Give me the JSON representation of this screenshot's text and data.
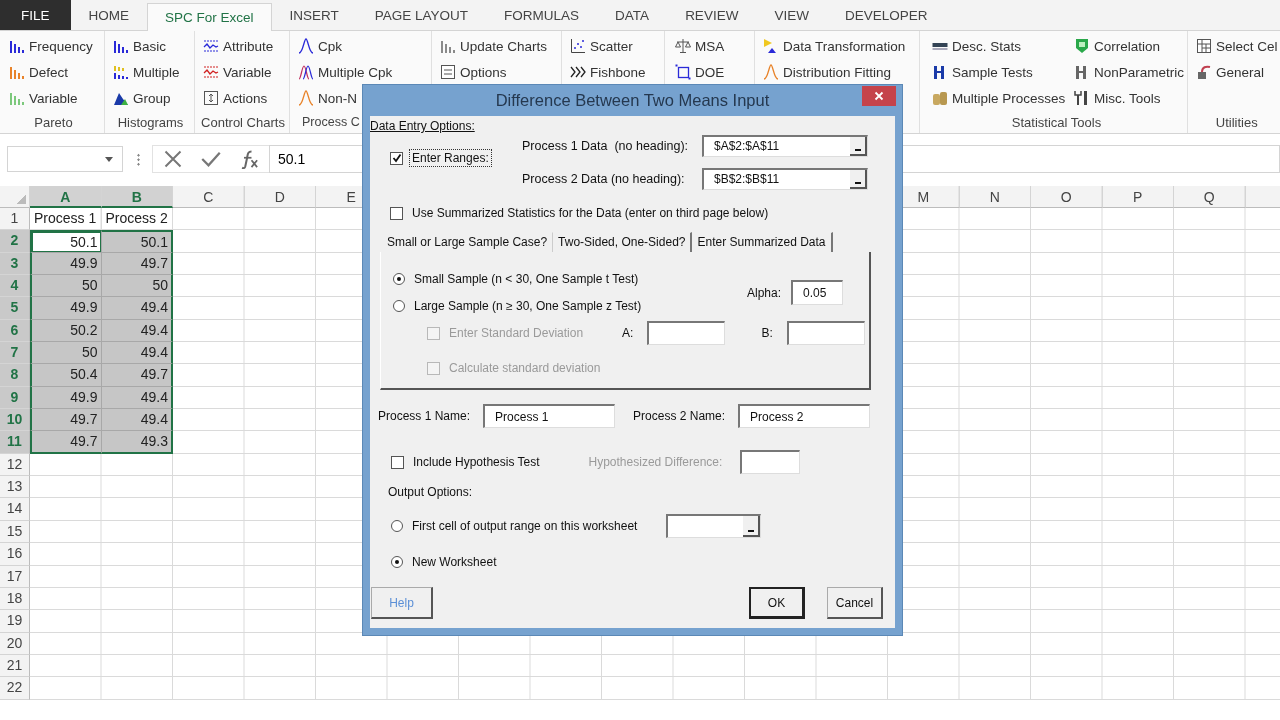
{
  "ribbon": {
    "tabs": [
      {
        "label": "FILE",
        "kind": "file",
        "selected": false
      },
      {
        "label": "HOME",
        "kind": "tab",
        "selected": false
      },
      {
        "label": "SPC For Excel",
        "kind": "tab",
        "selected": true
      },
      {
        "label": "INSERT",
        "kind": "tab",
        "selected": false
      },
      {
        "label": "PAGE LAYOUT",
        "kind": "tab",
        "selected": false
      },
      {
        "label": "FORMULAS",
        "kind": "tab",
        "selected": false
      },
      {
        "label": "DATA",
        "kind": "tab",
        "selected": false
      },
      {
        "label": "REVIEW",
        "kind": "tab",
        "selected": false
      },
      {
        "label": "VIEW",
        "kind": "tab",
        "selected": false
      },
      {
        "label": "DEVELOPER",
        "kind": "tab",
        "selected": false
      }
    ],
    "groups": [
      {
        "label": "Pareto",
        "items": [
          "Frequency",
          "Defect",
          "Variable"
        ]
      },
      {
        "label": "Histograms",
        "items": [
          "Basic",
          "Multiple",
          "Group"
        ]
      },
      {
        "label": "Control Charts",
        "items": [
          "Attribute",
          "Variable",
          "Actions"
        ]
      },
      {
        "label": "Process C",
        "items": [
          "Cpk",
          "Multiple Cpk",
          "Non-N"
        ]
      },
      {
        "items": [
          "Update Charts",
          "Options"
        ]
      },
      {
        "items": [
          "Scatter",
          "Fishbone"
        ]
      },
      {
        "items": [
          "MSA",
          "DOE"
        ]
      },
      {
        "items": [
          "Data Transformation",
          "Distribution Fitting"
        ]
      },
      {
        "label": "Statistical Tools",
        "items": [
          "Desc. Stats",
          "Sample Tests",
          "Multiple Processes",
          "Correlation",
          "NonParametric",
          "Misc. Tools"
        ]
      },
      {
        "label": "Utilities",
        "items": [
          "Select Cel",
          "General"
        ]
      }
    ]
  },
  "formula_bar": {
    "value": "50.1"
  },
  "sheet": {
    "columns": [
      {
        "label": "A",
        "selected": true
      },
      {
        "label": "B",
        "selected": true
      },
      {
        "label": "C",
        "selected": false
      },
      {
        "label": "D",
        "selected": false
      },
      {
        "label": "E",
        "selected": false
      }
    ],
    "columns_right": [
      {
        "label": "M",
        "selected": false
      },
      {
        "label": "N",
        "selected": false
      },
      {
        "label": "O",
        "selected": false
      },
      {
        "label": "P",
        "selected": false
      },
      {
        "label": "Q",
        "selected": false
      }
    ],
    "rows": [
      {
        "number": "1",
        "selected": false,
        "cells": [
          {
            "value": "Process 1",
            "selected": false,
            "active": false
          },
          {
            "value": "Process 2",
            "selected": false,
            "active": false
          }
        ]
      },
      {
        "number": "2",
        "selected": true,
        "cells": [
          {
            "value": "50.1",
            "selected": true,
            "active": true
          },
          {
            "value": "50.1",
            "selected": true,
            "active": false
          }
        ]
      },
      {
        "number": "3",
        "selected": true,
        "cells": [
          {
            "value": "49.9",
            "selected": true,
            "active": false
          },
          {
            "value": "49.7",
            "selected": true,
            "active": false
          }
        ]
      },
      {
        "number": "4",
        "selected": true,
        "cells": [
          {
            "value": "50",
            "selected": true,
            "active": false
          },
          {
            "value": "50",
            "selected": true,
            "active": false
          }
        ]
      },
      {
        "number": "5",
        "selected": true,
        "cells": [
          {
            "value": "49.9",
            "selected": true,
            "active": false
          },
          {
            "value": "49.4",
            "selected": true,
            "active": false
          }
        ]
      },
      {
        "number": "6",
        "selected": true,
        "cells": [
          {
            "value": "50.2",
            "selected": true,
            "active": false
          },
          {
            "value": "49.4",
            "selected": true,
            "active": false
          }
        ]
      },
      {
        "number": "7",
        "selected": true,
        "cells": [
          {
            "value": "50",
            "selected": true,
            "active": false
          },
          {
            "value": "49.4",
            "selected": true,
            "active": false
          }
        ]
      },
      {
        "number": "8",
        "selected": true,
        "cells": [
          {
            "value": "50.4",
            "selected": true,
            "active": false
          },
          {
            "value": "49.7",
            "selected": true,
            "active": false
          }
        ]
      },
      {
        "number": "9",
        "selected": true,
        "cells": [
          {
            "value": "49.9",
            "selected": true,
            "active": false
          },
          {
            "value": "49.4",
            "selected": true,
            "active": false
          }
        ]
      },
      {
        "number": "10",
        "selected": true,
        "cells": [
          {
            "value": "49.7",
            "selected": true,
            "active": false
          },
          {
            "value": "49.4",
            "selected": true,
            "active": false
          }
        ]
      },
      {
        "number": "11",
        "selected": true,
        "cells": [
          {
            "value": "49.7",
            "selected": true,
            "active": false
          },
          {
            "value": "49.3",
            "selected": true,
            "active": false
          }
        ]
      },
      {
        "number": "12",
        "selected": false
      },
      {
        "number": "13",
        "selected": false
      },
      {
        "number": "14",
        "selected": false
      },
      {
        "number": "15",
        "selected": false
      },
      {
        "number": "16",
        "selected": false
      },
      {
        "number": "17",
        "selected": false
      },
      {
        "number": "18",
        "selected": false
      },
      {
        "number": "19",
        "selected": false
      },
      {
        "number": "20",
        "selected": false
      },
      {
        "number": "21",
        "selected": false
      },
      {
        "number": "22",
        "selected": false
      }
    ]
  },
  "dialog": {
    "title": "Difference Between Two Means Input",
    "section_label": "Data Entry Options:",
    "enter_ranges": {
      "label": "Enter Ranges:",
      "checked": true,
      "focused": true
    },
    "range_fields": [
      {
        "label": "Process 1 Data  (no heading):",
        "value": "$A$2:$A$11"
      },
      {
        "label": "Process 2 Data (no heading):",
        "value": "$B$2:$B$11"
      }
    ],
    "use_summarized": {
      "label": "Use Summarized Statistics for the Data (enter on third page below)",
      "checked": false
    },
    "tabs": [
      {
        "label": "Small or Large Sample Case?",
        "selected": true
      },
      {
        "label": "Two-Sided, One-Sided?",
        "selected": false
      },
      {
        "label": "Enter Summarized Data",
        "selected": false
      }
    ],
    "sample_options": [
      {
        "label": "Small Sample (n < 30, One Sample t Test)",
        "selected": true
      },
      {
        "label": "Large Sample (n ≥ 30, One Sample z Test)",
        "selected": false
      }
    ],
    "alpha": {
      "label": "Alpha:",
      "value": "0.05"
    },
    "std_options": [
      {
        "label": "Enter Standard Deviation",
        "checked": false,
        "disabled": true
      },
      {
        "label": "Calculate standard deviation",
        "checked": false,
        "disabled": true
      }
    ],
    "std_fields": [
      {
        "label": "A:"
      },
      {
        "label": "B:"
      }
    ],
    "name_fields": [
      {
        "label": "Process 1 Name:",
        "value": "Process 1"
      },
      {
        "label": "Process 2 Name:",
        "value": "Process 2"
      }
    ],
    "hypothesis": {
      "label": "Include Hypothesis Test",
      "checked": false
    },
    "hypothesized_difference": {
      "label": "Hypothesized Difference:",
      "disabled": true
    },
    "output_label": "Output Options:",
    "output_options": [
      {
        "label": "First cell of output range on this worksheet",
        "selected": false
      },
      {
        "label": "New Worksheet",
        "selected": true
      }
    ],
    "buttons": [
      {
        "label": "Help",
        "kind": "help"
      },
      {
        "label": "OK",
        "kind": "default"
      },
      {
        "label": "Cancel",
        "kind": "normal"
      }
    ]
  }
}
